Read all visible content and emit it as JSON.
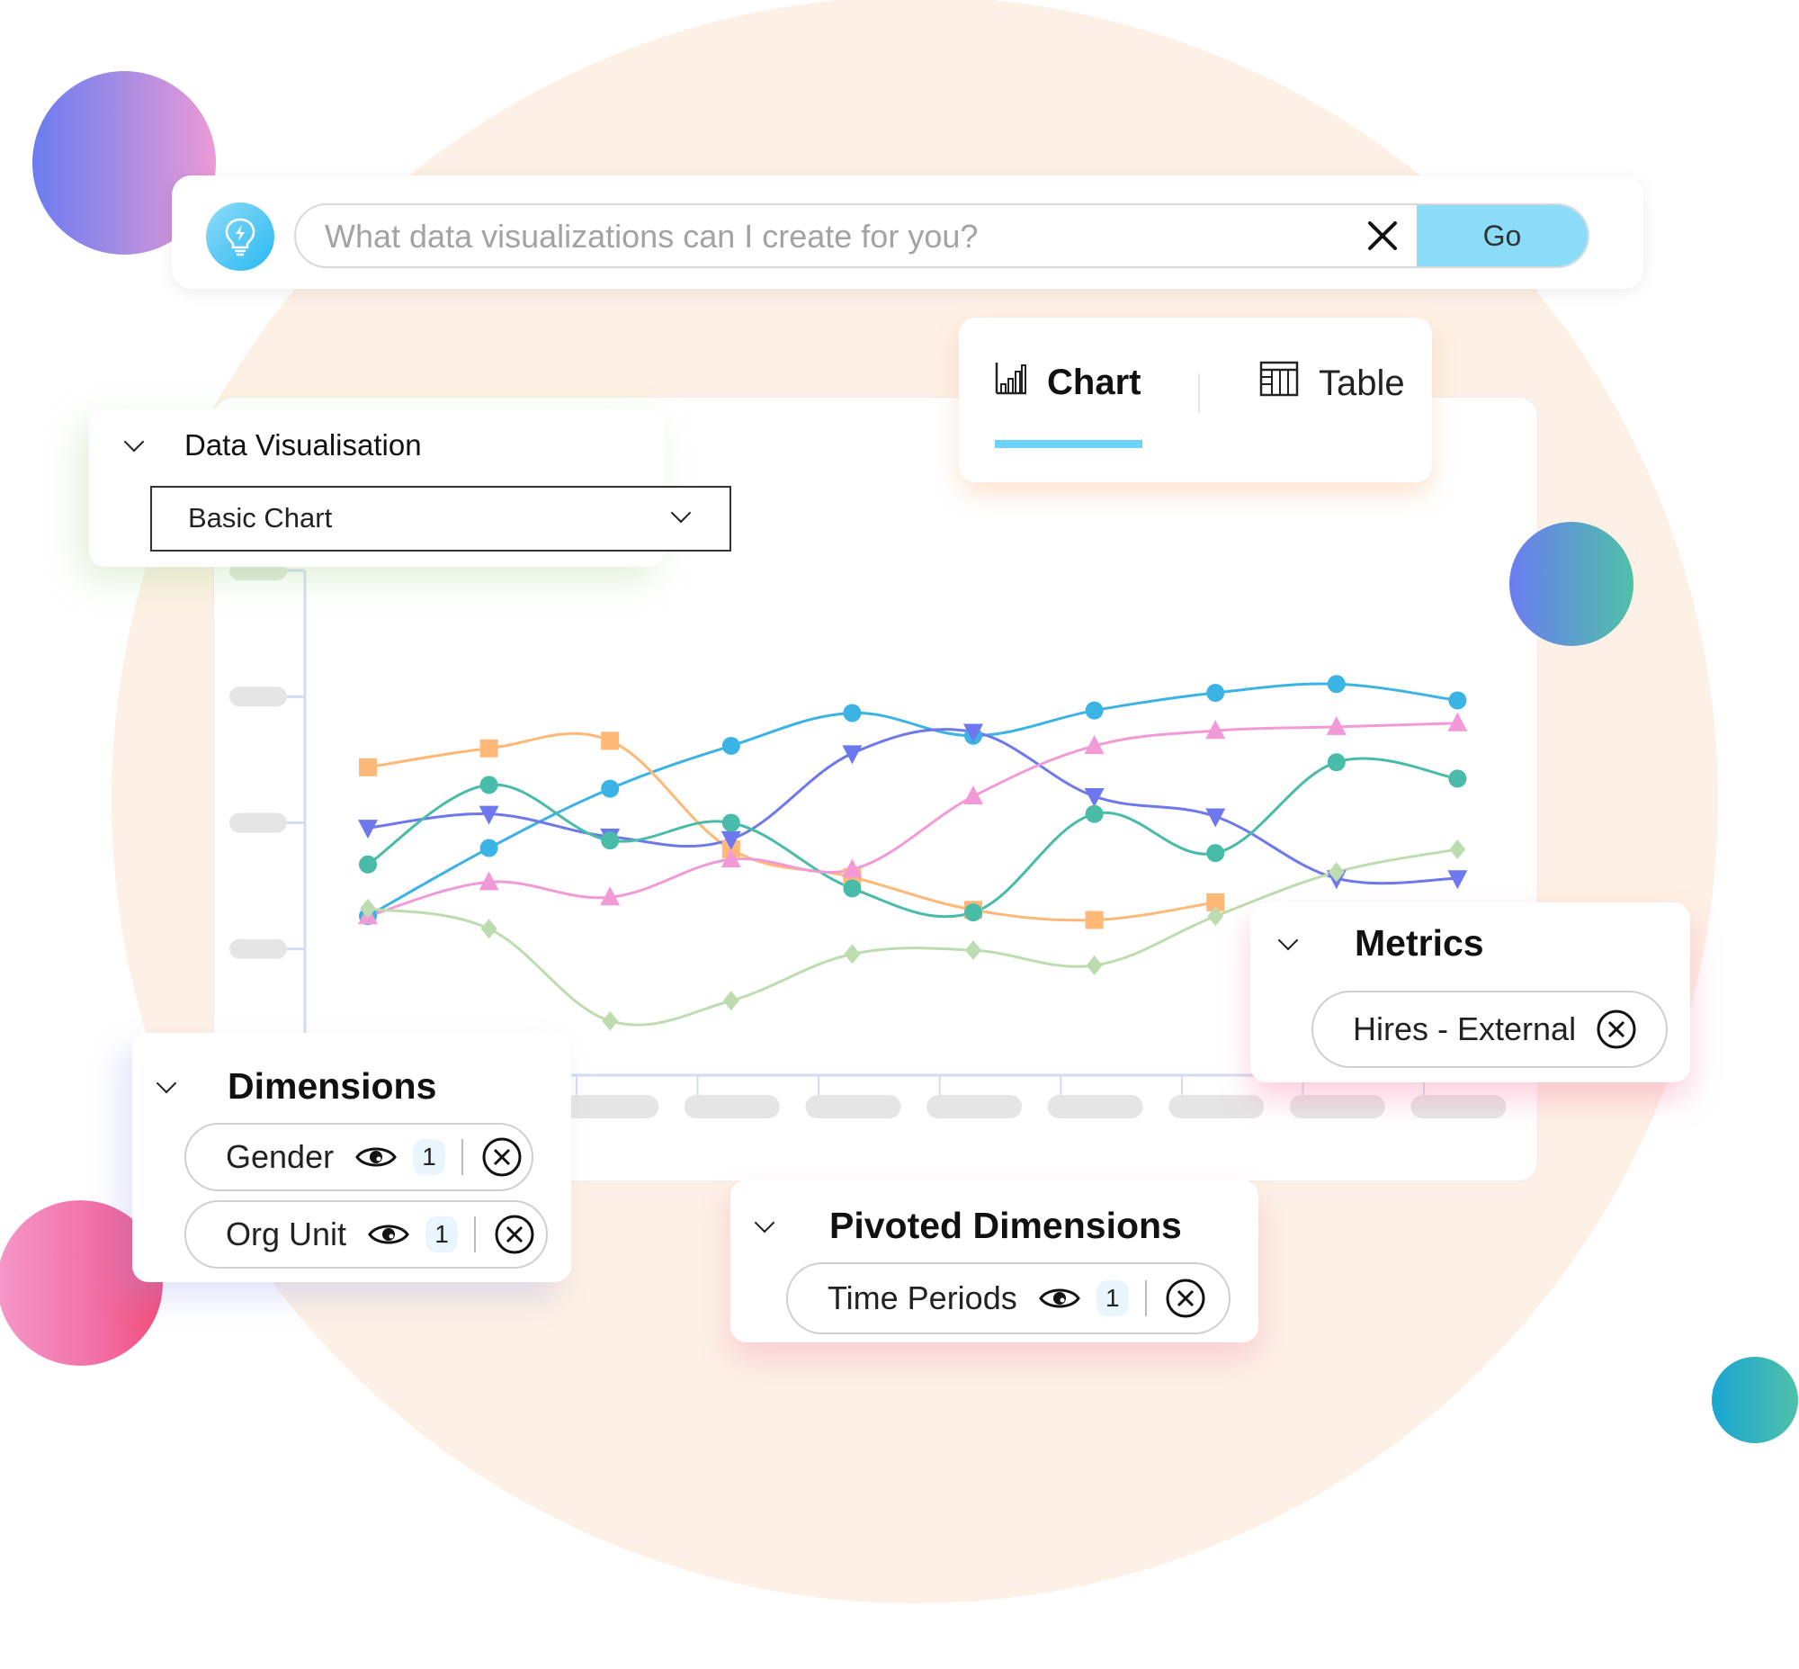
{
  "search": {
    "placeholder": "What data visualizations can I create for you?",
    "value": "",
    "go_label": "Go",
    "assistant_icon": "lightbulb-bolt-icon",
    "clear_icon": "close-icon"
  },
  "view_tabs": [
    {
      "label": "Chart",
      "icon": "bar-chart-icon",
      "active": true
    },
    {
      "label": "Table",
      "icon": "table-icon",
      "active": false
    }
  ],
  "data_visualisation": {
    "title": "Data Visualisation",
    "chart_type": "Basic Chart"
  },
  "dimensions": {
    "title": "Dimensions",
    "items": [
      {
        "label": "Gender",
        "count": "1"
      },
      {
        "label": "Org Unit",
        "count": "1"
      }
    ]
  },
  "pivoted_dimensions": {
    "title": "Pivoted Dimensions",
    "items": [
      {
        "label": "Time Periods",
        "count": "1"
      }
    ]
  },
  "metrics": {
    "title": "Metrics",
    "items": [
      {
        "label": "Hires - External"
      }
    ]
  },
  "colors": {
    "go_button": "#8adcf8",
    "tab_underline": "#6ed3f8",
    "background_circle": "#fdf0e4"
  },
  "chart_data": {
    "type": "line",
    "title": "",
    "xlabel": "",
    "ylabel": "",
    "categories": [
      "",
      "",
      "",
      "",
      "",
      "",
      "",
      "",
      "",
      ""
    ],
    "y_ticks_masked": true,
    "x_ticks_masked": true,
    "ylim": [
      0,
      4
    ],
    "grid": false,
    "legend": "none",
    "series": [
      {
        "name": "series-blue",
        "color": "#3bb3e4",
        "marker": "circle",
        "values": [
          1.26,
          1.8,
          2.27,
          2.61,
          2.87,
          2.69,
          2.89,
          3.03,
          3.1,
          2.97
        ]
      },
      {
        "name": "series-orange",
        "color": "#ffb877",
        "marker": "square",
        "values": [
          2.44,
          2.59,
          2.65,
          1.79,
          1.57,
          1.31,
          1.23,
          1.37,
          null,
          null
        ]
      },
      {
        "name": "series-purple",
        "color": "#6c78ec",
        "marker": "triangle-down",
        "values": [
          1.96,
          2.07,
          1.89,
          1.87,
          2.55,
          2.72,
          2.21,
          2.05,
          1.56,
          1.56
        ]
      },
      {
        "name": "series-teal",
        "color": "#48bba9",
        "marker": "circle",
        "values": [
          1.67,
          2.3,
          1.86,
          2.0,
          1.48,
          1.29,
          2.07,
          1.76,
          2.48,
          2.35
        ]
      },
      {
        "name": "series-pink",
        "color": "#f29ad8",
        "marker": "triangle-up",
        "values": [
          1.26,
          1.53,
          1.41,
          1.71,
          1.63,
          2.21,
          2.61,
          2.73,
          2.76,
          2.79
        ]
      },
      {
        "name": "series-green",
        "color": "#bddcb0",
        "marker": "diamond",
        "values": [
          1.32,
          1.16,
          0.43,
          0.59,
          0.96,
          0.99,
          0.87,
          1.26,
          1.61,
          1.79
        ]
      }
    ]
  }
}
